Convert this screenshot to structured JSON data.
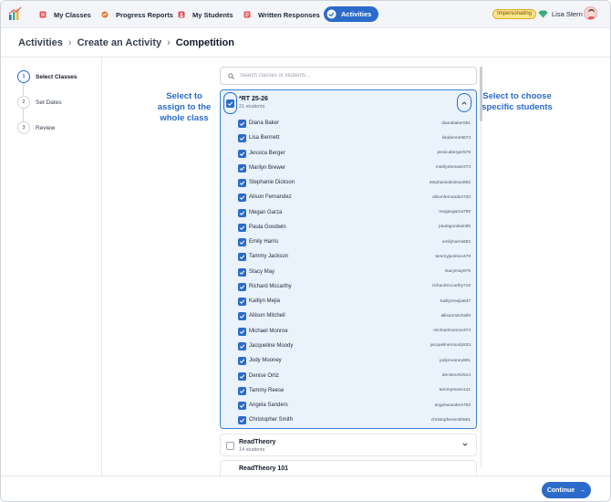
{
  "nav": {
    "items": [
      {
        "label": "My Classes",
        "icon": "classes-icon",
        "color": "#e0525a"
      },
      {
        "label": "Progress Reports",
        "icon": "progress-icon",
        "color": "#e07a3a"
      },
      {
        "label": "My Students",
        "icon": "students-icon",
        "color": "#e0525a"
      },
      {
        "label": "Written Responses",
        "icon": "responses-icon",
        "color": "#e0525a"
      },
      {
        "label": "Activities",
        "icon": "activities-icon",
        "active": true
      }
    ],
    "impersonating_badge": "Impersonating",
    "user_name": "Lisa Stern"
  },
  "breadcrumb": {
    "items": [
      "Activities",
      "Create an Activity"
    ],
    "current": "Competition",
    "separator": "›"
  },
  "steps": [
    {
      "number": "1",
      "label": "Select Classes",
      "active": true
    },
    {
      "number": "2",
      "label": "Set Dates",
      "active": false
    },
    {
      "number": "3",
      "label": "Review",
      "active": false
    }
  ],
  "annotations": {
    "left": "Select to assign to the whole class",
    "right": "Select to choose specific students"
  },
  "search": {
    "placeholder": "Search classes or students..."
  },
  "expanded_class": {
    "name": "*RT 25-26",
    "count": "21 students",
    "checked": true,
    "students": [
      {
        "name": "Diana Baker",
        "username": "dianabaker561"
      },
      {
        "name": "Lisa Bennett",
        "username": "lisabennett673"
      },
      {
        "name": "Jessica Berger",
        "username": "jessicaberger578"
      },
      {
        "name": "Marilyn Brewer",
        "username": "marilynbrewer273"
      },
      {
        "name": "Stephanie Dickson",
        "username": "stephaniedickson892"
      },
      {
        "name": "Alison Fernandez",
        "username": "alisonfernandez720"
      },
      {
        "name": "Megan Garza",
        "username": "megangarza799"
      },
      {
        "name": "Paula Goodwin",
        "username": "paulagoodwin85"
      },
      {
        "name": "Emily Harris",
        "username": "emilyharris692"
      },
      {
        "name": "Tammy Jackson",
        "username": "tammyjackson479"
      },
      {
        "name": "Stacy May",
        "username": "stacymay975"
      },
      {
        "name": "Richard Mccarthy",
        "username": "richardmccarthy719"
      },
      {
        "name": "Kaitlyn Mejia",
        "username": "kaitlynmejia647"
      },
      {
        "name": "Allison Mitchell",
        "username": "allisonmitchell9"
      },
      {
        "name": "Michael Monroe",
        "username": "michaelmonroe373"
      },
      {
        "name": "Jacqueline Moody",
        "username": "jacquelinemoody533"
      },
      {
        "name": "Jody Mooney",
        "username": "jodymooney801"
      },
      {
        "name": "Denise Ortiz",
        "username": "deniseortiz514"
      },
      {
        "name": "Tammy Reese",
        "username": "tammyreese141"
      },
      {
        "name": "Angela Sanders",
        "username": "angelasanders762"
      },
      {
        "name": "Christopher Smith",
        "username": "christophersmith561"
      }
    ]
  },
  "other_classes": [
    {
      "name": "ReadTheory",
      "count": "14 students",
      "checked": false
    },
    {
      "name": "ReadTheory 101",
      "count": "",
      "checked": false
    }
  ],
  "footer": {
    "continue_label": "Continue"
  },
  "colors": {
    "accent": "#2b6bc9",
    "panel_bg": "#eaf2fc",
    "badge_bg": "#fde68a"
  }
}
